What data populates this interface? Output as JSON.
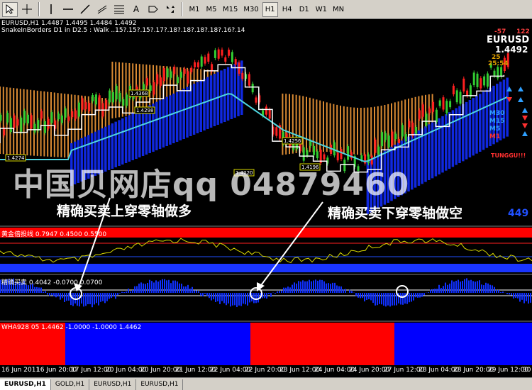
{
  "toolbar": {
    "timeframes": [
      "M1",
      "M5",
      "M15",
      "M30",
      "H1",
      "H4",
      "D1",
      "W1",
      "MN"
    ],
    "active_timeframe": "H1",
    "text_tool_label": "A"
  },
  "chart_header": {
    "symbol_line": "EURUSD,H1  1.4487 1.4495 1.4484 1.4492",
    "indicator_line": "SnakeInBorders D1 in D2.5 :  Walk ..15?.15?.15?.17?.18?.18?.18?.18?.16?.14"
  },
  "right_panel": {
    "value_left": "-57",
    "value_right": "122",
    "symbol": "EURUSD",
    "price": "1.4492",
    "line1": "25",
    "line2": "25:54",
    "timeframe_labels": [
      "M30",
      "M15",
      "M5",
      "M1"
    ],
    "footer": "TUNGGU!!!",
    "price_tail": "449"
  },
  "price_boxes": [
    "1.4368",
    "1.4274",
    "1.4298",
    "1.4256",
    "1.4196",
    "1.4220"
  ],
  "watermark": "中国贝网店qq 04879460",
  "annotations": {
    "buy": "精确买卖上穿零轴做多",
    "sell": "精确买卖下穿零轴做空"
  },
  "sub1_header": "黄金倍投线 0.7947 0.4500 0.5500",
  "sub2_header": "精确买卖 0.4042 -0.0700 0.0700",
  "sub3_header": "WHA928 05 1.4462 -1.0000 -1.0000 1.4462",
  "date_labels": [
    "16 Jun 2011",
    "16 Jun 20:00",
    "17 Jun 12:00",
    "20 Jun 04:00",
    "20 Jun 20:00",
    "21 Jun 12:00",
    "22 Jun 04:00",
    "22 Jun 20:00",
    "23 Jun 12:00",
    "24 Jun 04:00",
    "24 Jun 20:00",
    "27 Jun 12:00",
    "28 Jun 04:00",
    "28 Jun 20:00",
    "29 Jun 12:00",
    "30"
  ],
  "tabs": [
    "EURUSD,H1",
    "GOLD,H1",
    "EURUSD,H1",
    "EURUSD,H1"
  ],
  "active_tab": 0,
  "colors": {
    "chart_bg": "#000000",
    "cloud": "#d98a33",
    "blue_band": "#1028e0",
    "ma_cyan": "#4fd6e0",
    "step_line": "#ffffff",
    "bull_candle": "#32cd32",
    "bear_candle": "#ff2020",
    "sub3_red": "#ff0000",
    "sub3_blue": "#0000ff"
  }
}
